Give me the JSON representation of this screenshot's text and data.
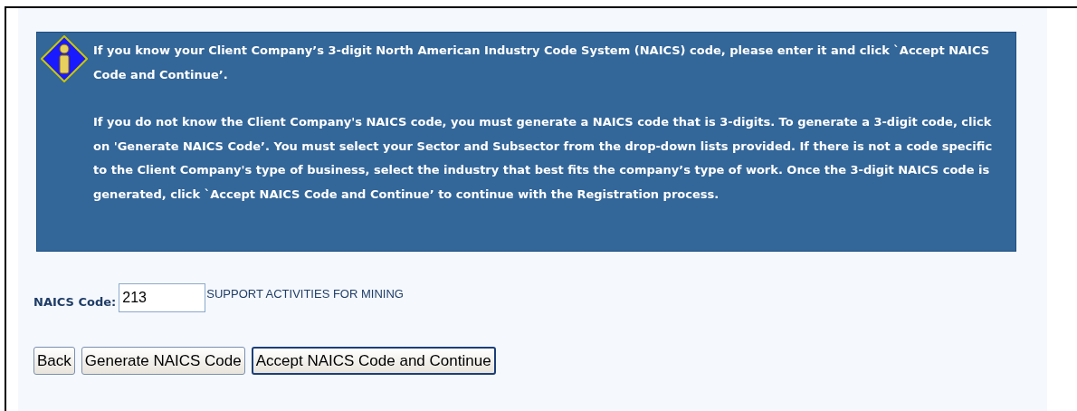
{
  "info_box": {
    "paragraphs": [
      "If you know your Client Company’s 3-digit North American Industry Code System (NAICS) code, please enter it and click `Accept NAICS Code and Continue’.",
      "If you do not know the Client Company's NAICS code, you must generate a NAICS code that is 3-digits. To generate a 3-digit code, click on 'Generate NAICS Code’. You must select your Sector and Subsector from the drop-down lists provided. If there is not a code specific to the Client Company's type of business, select the industry that best fits the company’s type of work. Once the 3-digit NAICS code is generated, click `Accept NAICS Code and Continue’ to continue with the Registration process."
    ]
  },
  "naics_field": {
    "label": "NAICS Code:",
    "value": "213",
    "description": "SUPPORT ACTIVITIES FOR MINING"
  },
  "buttons": [
    {
      "label": "Back",
      "default": false
    },
    {
      "label": "Generate NAICS Code",
      "default": false
    },
    {
      "label": "Accept NAICS Code and Continue",
      "default": true
    }
  ]
}
